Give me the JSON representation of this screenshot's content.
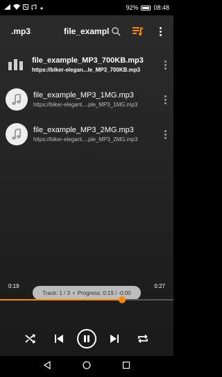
{
  "status_bar": {
    "battery": "92%",
    "time": "08:48"
  },
  "toolbar": {
    "left_title": ".mp3",
    "title": "file_example_",
    "icons": [
      "search-icon",
      "queue-music-icon",
      "more-vert-icon"
    ]
  },
  "playlist": [
    {
      "title": "file_example_MP3_700KB.mp3",
      "subtitle": "https://biker-elegan...le_MP3_700KB.mp3",
      "active": true,
      "icon": "equalizer-bars-icon"
    },
    {
      "title": "file_example_MP3_1MG.mp3",
      "subtitle": "https://biker-elegant....ple_MP3_1MG.mp3",
      "active": false,
      "icon": "music-note-icon"
    },
    {
      "title": "file_example_MP3_2MG.mp3",
      "subtitle": "https://biker-elegant....ple_MP3_2MG.mp3",
      "active": false,
      "icon": "music-note-icon"
    }
  ],
  "player": {
    "track_label": "Track: 1 / 3",
    "separator": "•",
    "progress_label": "Progress: 0:19 / -0:00",
    "elapsed": "0:19",
    "duration": "0:27",
    "progress_fraction": 0.704,
    "accent_color": "#ff8800",
    "controls": [
      "shuffle-icon",
      "previous-icon",
      "pause-icon",
      "next-icon",
      "repeat-icon"
    ]
  },
  "nav_bar": {
    "buttons": [
      "back-triangle-icon",
      "home-circle-icon",
      "recents-square-icon"
    ]
  }
}
